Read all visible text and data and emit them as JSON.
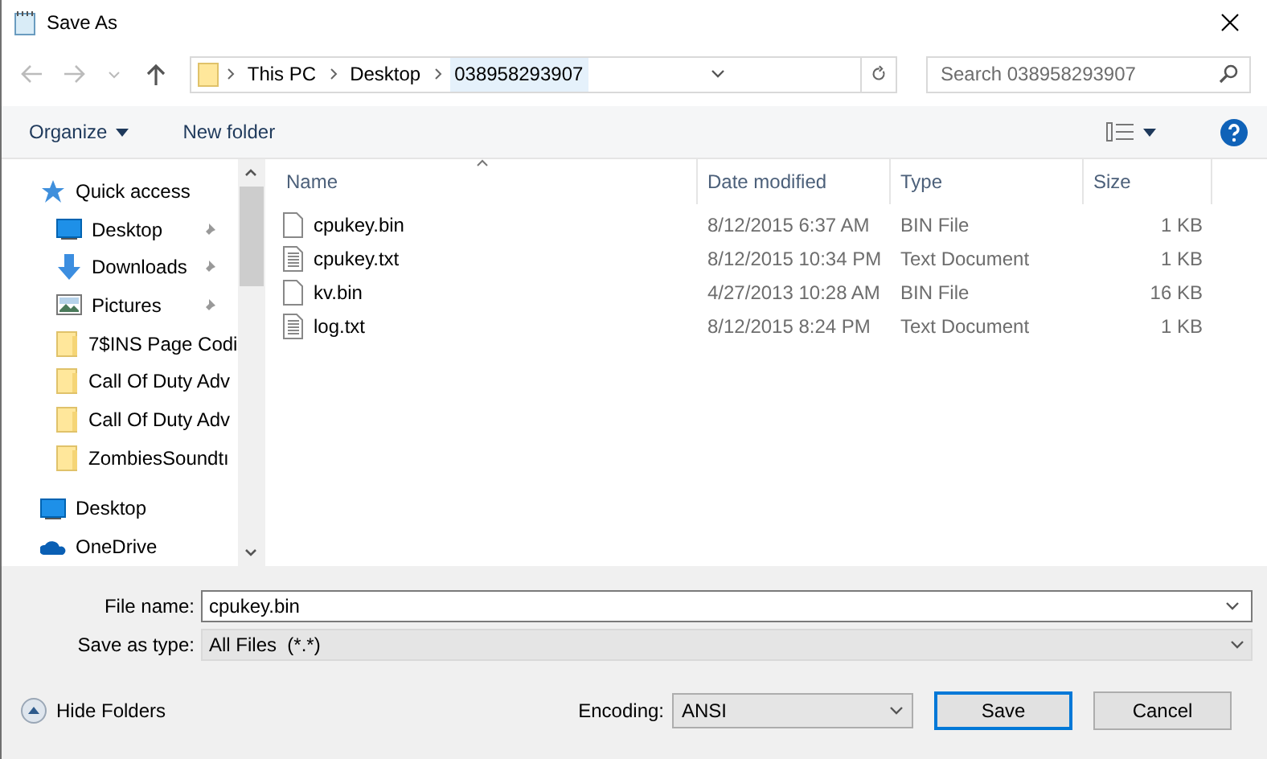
{
  "window": {
    "title": "Save As"
  },
  "breadcrumb": [
    {
      "label": "This PC",
      "selected": false
    },
    {
      "label": "Desktop",
      "selected": false
    },
    {
      "label": "038958293907",
      "selected": true
    }
  ],
  "search": {
    "placeholder": "Search 038958293907"
  },
  "toolbar": {
    "organize": "Organize",
    "new_folder": "New folder"
  },
  "nav": [
    {
      "label": "Quick access",
      "kind": "star",
      "pinned": false
    },
    {
      "label": "Desktop",
      "kind": "desktop",
      "pinned": true
    },
    {
      "label": "Downloads",
      "kind": "download",
      "pinned": true
    },
    {
      "label": "Pictures",
      "kind": "pictures",
      "pinned": true
    },
    {
      "label": "7$INS Page Codi",
      "kind": "folder",
      "pinned": false
    },
    {
      "label": "Call Of Duty Adv",
      "kind": "folder",
      "pinned": false
    },
    {
      "label": "Call Of Duty Adv",
      "kind": "folder",
      "pinned": false
    },
    {
      "label": "ZombiesSoundtı",
      "kind": "folder",
      "pinned": false
    },
    {
      "label": "Desktop",
      "kind": "pc-desktop",
      "pinned": false
    },
    {
      "label": "OneDrive",
      "kind": "onedrive",
      "pinned": false
    }
  ],
  "table": {
    "columns": [
      "Name",
      "Date modified",
      "Type",
      "Size"
    ],
    "rows": [
      {
        "name": "cpukey.bin",
        "kind": "blank",
        "date": "8/12/2015 6:37 AM",
        "type": "BIN File",
        "size": "1 KB"
      },
      {
        "name": "cpukey.txt",
        "kind": "text",
        "date": "8/12/2015 10:34 PM",
        "type": "Text Document",
        "size": "1 KB"
      },
      {
        "name": "kv.bin",
        "kind": "blank",
        "date": "4/27/2013 10:28 AM",
        "type": "BIN File",
        "size": "16 KB"
      },
      {
        "name": "log.txt",
        "kind": "text",
        "date": "8/12/2015 8:24 PM",
        "type": "Text Document",
        "size": "1 KB"
      }
    ]
  },
  "form": {
    "file_name_label": "File name:",
    "file_name": "cpukey.bin",
    "type_label": "Save as type:",
    "type_value": "All Files  (*.*)"
  },
  "footer": {
    "hide_folders": "Hide Folders",
    "encoding_label": "Encoding:",
    "encoding": "ANSI",
    "save": "Save",
    "cancel": "Cancel"
  }
}
